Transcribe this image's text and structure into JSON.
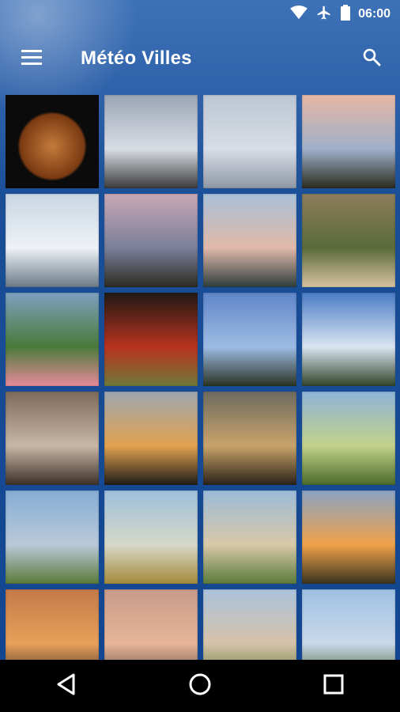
{
  "status_bar": {
    "time": "06:00",
    "icons": [
      "wifi-icon",
      "airplane-icon",
      "battery-icon"
    ]
  },
  "toolbar": {
    "title": "Météo Villes",
    "menu_icon": "hamburger-menu-icon",
    "search_icon": "search-icon"
  },
  "photos": [
    {
      "subject": "full-moon",
      "colors": [
        "#0b0b0b",
        "#c47a3a",
        "#7a3a12"
      ]
    },
    {
      "subject": "sunrays-through-clouds",
      "colors": [
        "#9aa6b6",
        "#d9dde4",
        "#3b3b3d"
      ]
    },
    {
      "subject": "birds-in-grey-sky",
      "colors": [
        "#bcc6d2",
        "#d7dde6",
        "#8f98a5"
      ]
    },
    {
      "subject": "sunset-over-trees",
      "colors": [
        "#e7b7a5",
        "#9fb0c9",
        "#2b2a1f"
      ]
    },
    {
      "subject": "snowy-lake-shore",
      "colors": [
        "#c9d6e2",
        "#eef2f6",
        "#6a7a86"
      ]
    },
    {
      "subject": "pink-sunset-trees",
      "colors": [
        "#c9a7b5",
        "#7a7f9a",
        "#2d2b22"
      ]
    },
    {
      "subject": "lake-with-boats",
      "colors": [
        "#a9c0d8",
        "#e0b9a8",
        "#2f3d3e"
      ]
    },
    {
      "subject": "autumn-leaves",
      "colors": [
        "#8c7d5c",
        "#5a6b3a",
        "#d7c1a0"
      ]
    },
    {
      "subject": "apples-under-tree",
      "colors": [
        "#7fa0bf",
        "#4a7a3a",
        "#e88a9a"
      ]
    },
    {
      "subject": "red-ivy-leaves",
      "colors": [
        "#1f1a16",
        "#b8321e",
        "#6f7a3a"
      ]
    },
    {
      "subject": "tower-blue-sky",
      "colors": [
        "#5f86c9",
        "#9dbbe3",
        "#2a3324"
      ]
    },
    {
      "subject": "clouds-over-field",
      "colors": [
        "#4b7cc6",
        "#d9e4f0",
        "#30452a"
      ]
    },
    {
      "subject": "wheat-plumes",
      "colors": [
        "#7d6a5a",
        "#c9b7a5",
        "#3b2f28"
      ]
    },
    {
      "subject": "sunset-tree-silhouette",
      "colors": [
        "#9da6b0",
        "#e2a24f",
        "#1f1c18"
      ]
    },
    {
      "subject": "rainbow",
      "colors": [
        "#6d6a60",
        "#c9a36a",
        "#2a2218"
      ]
    },
    {
      "subject": "green-landscape",
      "colors": [
        "#8fb3d9",
        "#c2d28a",
        "#4a6a2a"
      ]
    },
    {
      "subject": "hills-landscape",
      "colors": [
        "#86acd4",
        "#b9c9d8",
        "#5a7a3a"
      ]
    },
    {
      "subject": "morning-field",
      "colors": [
        "#9ec0dc",
        "#d6d8c8",
        "#a58a3a"
      ]
    },
    {
      "subject": "field-with-trees",
      "colors": [
        "#9bbbd8",
        "#d8c8a8",
        "#5a7a3a"
      ]
    },
    {
      "subject": "sunrise-horizon",
      "colors": [
        "#8aa3c4",
        "#f0a24a",
        "#3a3320"
      ]
    },
    {
      "subject": "orange-sky",
      "colors": [
        "#c37a48",
        "#e9a05a",
        "#3a2a22"
      ]
    },
    {
      "subject": "pink-orange-sky",
      "colors": [
        "#c79a8a",
        "#e8b597",
        "#5a4a44"
      ]
    },
    {
      "subject": "pasture-with-cows",
      "colors": [
        "#aac3dc",
        "#d6c2a8",
        "#5f7a3a"
      ]
    },
    {
      "subject": "mountain-valley",
      "colors": [
        "#9fc0e2",
        "#c9d9ea",
        "#3e5f2a"
      ]
    }
  ],
  "nav": {
    "back_icon": "back-triangle-icon",
    "home_icon": "home-circle-icon",
    "recents_icon": "recents-square-icon"
  }
}
